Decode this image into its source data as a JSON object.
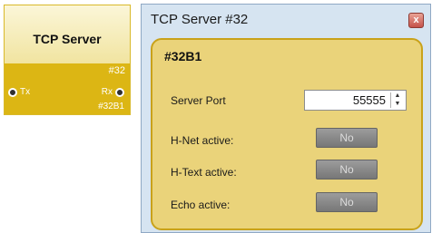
{
  "node": {
    "title": "TCP Server",
    "number": "#32",
    "tx_label": "Tx",
    "rx_label": "Rx",
    "code": "#32B1",
    "accent": "#dcb614"
  },
  "window": {
    "title": "TCP Server #32",
    "close_label": "x",
    "panel": {
      "heading": "#32B1",
      "server_port_label": "Server Port",
      "server_port_value": "55555",
      "hnet_label": "H-Net active:",
      "hnet_value": "No",
      "htext_label": "H-Text active:",
      "htext_value": "No",
      "echo_label": "Echo active:",
      "echo_value": "No"
    }
  },
  "icons": [
    "tx-port-icon",
    "rx-port-icon",
    "close-icon",
    "spin-up-icon",
    "spin-down-icon"
  ]
}
